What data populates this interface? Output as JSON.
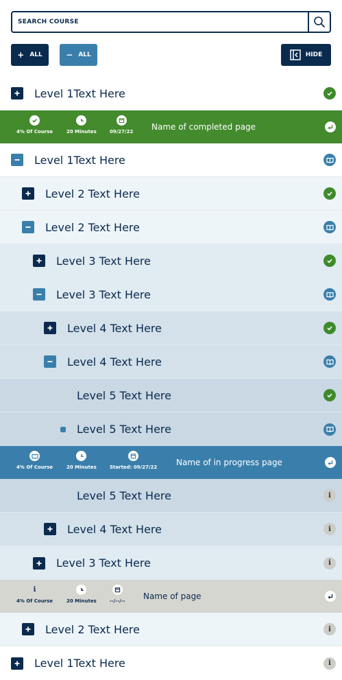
{
  "search": {
    "placeholder": "SEARCH COURSE",
    "value": ""
  },
  "toolbar": {
    "expand_all": "ALL",
    "collapse_all": "ALL",
    "hide": "HIDE"
  },
  "tree": [
    {
      "label": "Level 1Text Here",
      "toggle": "plus",
      "status": "complete"
    },
    {
      "panel": "completed",
      "percent": "4% Of Course",
      "time": "20 Minutes",
      "date": "09/27/22",
      "name": "Name of completed page"
    },
    {
      "label": "Level 1Text Here",
      "toggle": "minus",
      "status": "in-progress"
    },
    {
      "label": "Level 2 Text Here",
      "toggle": "plus",
      "status": "complete"
    },
    {
      "label": "Level 2 Text Here",
      "toggle": "minus",
      "status": "in-progress"
    },
    {
      "label": "Level 3 Text Here",
      "toggle": "plus",
      "status": "complete"
    },
    {
      "label": "Level 3 Text Here",
      "toggle": "minus",
      "status": "in-progress"
    },
    {
      "label": "Level 4 Text Here",
      "toggle": "plus",
      "status": "complete"
    },
    {
      "label": "Level 4 Text Here",
      "toggle": "minus",
      "status": "in-progress"
    },
    {
      "label": "Level 5 Text Here",
      "toggle": "none",
      "status": "complete"
    },
    {
      "label": "Level 5 Text Here",
      "toggle": "bullet",
      "status": "in-progress"
    },
    {
      "panel": "in-progress",
      "percent": "4% Of Course",
      "time": "20 Minutes",
      "date": "Started: 09/27/22",
      "name": "Name of in progress page"
    },
    {
      "label": "Level 5 Text Here",
      "toggle": "none",
      "status": "not-started"
    },
    {
      "label": "Level 4 Text Here",
      "toggle": "plus",
      "status": "not-started"
    },
    {
      "label": "Level 3 Text Here",
      "toggle": "plus",
      "status": "not-started"
    },
    {
      "panel": "not-started",
      "percent": "4% Of Course",
      "time": "20 Minutes",
      "date": "--/--/--",
      "name": "Name of page"
    },
    {
      "label": "Level 2 Text Here",
      "toggle": "plus",
      "status": "not-started"
    },
    {
      "label": "Level 1Text Here",
      "toggle": "plus",
      "status": "not-started"
    }
  ],
  "status_icons": {
    "complete": "check-icon",
    "in-progress": "book-icon",
    "not-started": "info-icon"
  },
  "colors": {
    "navy": "#0a2a4e",
    "accent_blue": "#3a7fab",
    "complete_green": "#438b2d",
    "neutral_gray": "#d6d6d0"
  }
}
